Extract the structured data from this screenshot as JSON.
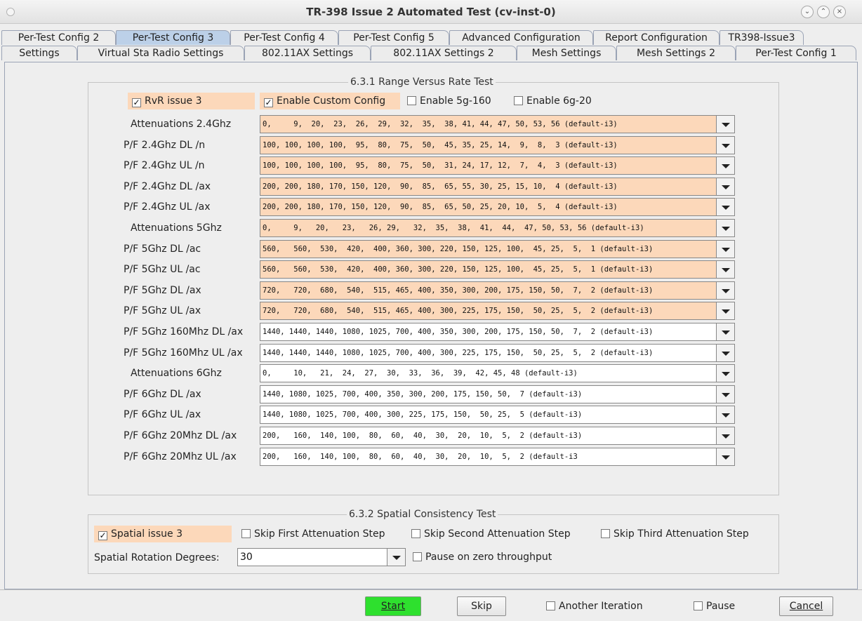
{
  "window": {
    "title": "TR-398 Issue 2 Automated Test  (cv-inst-0)"
  },
  "tabs_row1": [
    {
      "label": "Per-Test Config 2",
      "active": false
    },
    {
      "label": "Per-Test Config 3",
      "active": true
    },
    {
      "label": "Per-Test Config 4",
      "active": false
    },
    {
      "label": "Per-Test Config 5",
      "active": false
    },
    {
      "label": "Advanced Configuration",
      "active": false
    },
    {
      "label": "Report Configuration",
      "active": false
    },
    {
      "label": "TR398-Issue3",
      "active": false
    }
  ],
  "tabs_row2": [
    {
      "label": "Settings"
    },
    {
      "label": "Virtual Sta Radio Settings"
    },
    {
      "label": "802.11AX Settings"
    },
    {
      "label": "802.11AX Settings 2"
    },
    {
      "label": "Mesh Settings"
    },
    {
      "label": "Mesh Settings 2"
    },
    {
      "label": "Per-Test Config 1"
    }
  ],
  "rvr": {
    "title": "6.3.1 Range Versus Rate Test",
    "rvr_issue3": {
      "label": "RvR issue 3",
      "checked": true
    },
    "custom_config": {
      "label": "Enable Custom Config",
      "checked": true
    },
    "enable_5g160": {
      "label": "Enable 5g-160",
      "checked": false
    },
    "enable_6g20": {
      "label": "Enable 6g-20",
      "checked": false
    },
    "rows": [
      {
        "label": "Attenuations 2.4Ghz",
        "value": "0,     9,  20,  23,  26,  29,  32,  35,  38, 41, 44, 47, 50, 53, 56 (default-i3)",
        "highlight": true
      },
      {
        "label": "P/F 2.4Ghz DL /n",
        "value": "100, 100, 100, 100,  95,  80,  75,  50,  45, 35, 25, 14,  9,  8,  3 (default-i3)",
        "highlight": true
      },
      {
        "label": "P/F 2.4Ghz UL /n",
        "value": "100, 100, 100, 100,  95,  80,  75,  50,  31, 24, 17, 12,  7,  4,  3 (default-i3)",
        "highlight": true
      },
      {
        "label": "P/F 2.4Ghz DL /ax",
        "value": "200, 200, 180, 170, 150, 120,  90,  85,  65, 55, 30, 25, 15, 10,  4 (default-i3)",
        "highlight": true
      },
      {
        "label": "P/F 2.4Ghz UL /ax",
        "value": "200, 200, 180, 170, 150, 120,  90,  85,  65, 50, 25, 20, 10,  5,  4 (default-i3)",
        "highlight": true
      },
      {
        "label": "Attenuations 5Ghz",
        "value": "0,     9,   20,   23,   26, 29,   32,  35,  38,  41,  44,  47, 50, 53, 56 (default-i3)",
        "highlight": true
      },
      {
        "label": "P/F 5Ghz DL /ac",
        "value": "560,   560,  530,  420,  400, 360, 300, 220, 150, 125, 100,  45, 25,  5,  1 (default-i3)",
        "highlight": true
      },
      {
        "label": "P/F 5Ghz UL /ac",
        "value": "560,   560,  530,  420,  400, 360, 300, 220, 150, 125, 100,  45, 25,  5,  1 (default-i3)",
        "highlight": true
      },
      {
        "label": "P/F 5Ghz DL /ax",
        "value": "720,   720,  680,  540,  515, 465, 400, 350, 300, 200, 175, 150, 50,  7,  2 (default-i3)",
        "highlight": true
      },
      {
        "label": "P/F 5Ghz UL /ax",
        "value": "720,   720,  680,  540,  515, 465, 400, 300, 225, 175, 150,  50, 25,  5,  2 (default-i3)",
        "highlight": true
      },
      {
        "label": "P/F 5Ghz 160Mhz DL /ax",
        "value": "1440, 1440, 1440, 1080, 1025, 700, 400, 350, 300, 200, 175, 150, 50,  7,  2 (default-i3)",
        "highlight": false
      },
      {
        "label": "P/F 5Ghz 160Mhz UL /ax",
        "value": "1440, 1440, 1440, 1080, 1025, 700, 400, 300, 225, 175, 150,  50, 25,  5,  2 (default-i3)",
        "highlight": false
      },
      {
        "label": "Attenuations 6Ghz",
        "value": "0,     10,   21,  24,  27,  30,  33,  36,  39,  42, 45, 48 (default-i3)",
        "highlight": false
      },
      {
        "label": "P/F 6Ghz DL /ax",
        "value": "1440, 1080, 1025, 700, 400, 350, 300, 200, 175, 150, 50,  7 (default-i3)",
        "highlight": false
      },
      {
        "label": "P/F 6Ghz UL /ax",
        "value": "1440, 1080, 1025, 700, 400, 300, 225, 175, 150,  50, 25,  5 (default-i3)",
        "highlight": false
      },
      {
        "label": "P/F 6Ghz 20Mhz DL /ax",
        "value": "200,   160,  140, 100,  80,  60,  40,  30,  20,  10,  5,  2 (default-i3)",
        "highlight": false
      },
      {
        "label": "P/F 6Ghz 20Mhz UL /ax",
        "value": "200,   160,  140, 100,  80,  60,  40,  30,  20,  10,  5,  2 (default-i3",
        "highlight": false
      }
    ]
  },
  "spatial": {
    "title": "6.3.2 Spatial Consistency Test",
    "issue3": {
      "label": "Spatial issue 3",
      "checked": true
    },
    "skip_first": {
      "label": "Skip First Attenuation Step",
      "checked": false
    },
    "skip_second": {
      "label": "Skip Second Attenuation Step",
      "checked": false
    },
    "skip_third": {
      "label": "Skip Third Attenuation Step",
      "checked": false
    },
    "rotation_label": "Spatial Rotation Degrees:",
    "rotation_value": "30",
    "pause_zero": {
      "label": "Pause on zero throughput",
      "checked": false
    }
  },
  "bottom": {
    "start": "Start",
    "skip": "Skip",
    "another_iteration": {
      "label": "Another Iteration",
      "checked": false
    },
    "pause": {
      "label": "Pause",
      "checked": false
    },
    "cancel": "Cancel"
  },
  "colors": {
    "highlight": "#fcd8ba",
    "active_tab": "#bcd0e8",
    "start_button": "#2ee02e"
  }
}
